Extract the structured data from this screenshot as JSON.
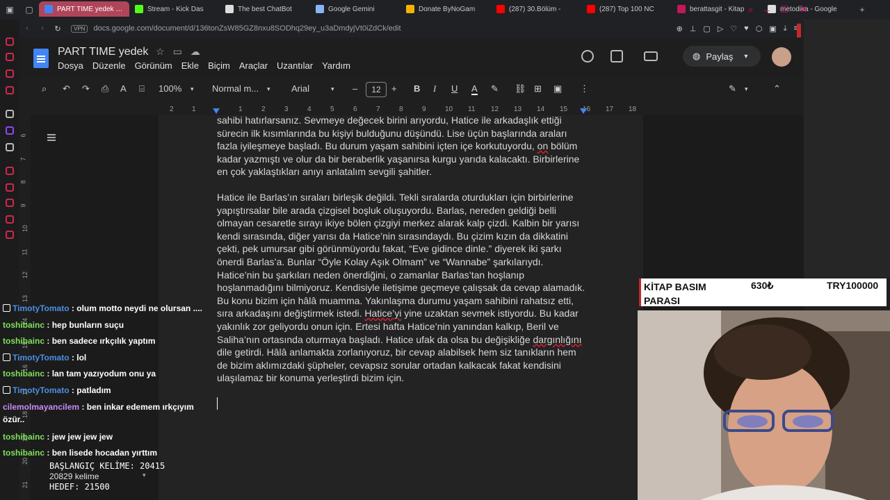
{
  "browser": {
    "tabs": [
      {
        "label": "PART TIME yedek - Goog",
        "color": "#4285f4",
        "active": true
      },
      {
        "label": "Stream - Kick Das",
        "color": "#53fc18"
      },
      {
        "label": "The best ChatBot",
        "color": "#dddddd"
      },
      {
        "label": "Google Gemini",
        "color": "#8ab4f8"
      },
      {
        "label": "Donate ByNoGam",
        "color": "#f4b400"
      },
      {
        "label": "(287) 30.Bölüm -",
        "color": "#ff0000"
      },
      {
        "label": "(287) Top 100 NC",
        "color": "#ff0000"
      },
      {
        "label": "berattasgit - Kitap",
        "color": "#c2185b"
      },
      {
        "label": "metodika - Google",
        "color": "#dddddd"
      }
    ],
    "vpn": "VPN",
    "url": "docs.google.com/document/d/136tonZsW85GZ8nxu8SODhq29ey_u3aDmdyjVt0iZdCk/edit"
  },
  "doc": {
    "title": "PART TIME  yedek",
    "menu": [
      "Dosya",
      "Düzenle",
      "Görünüm",
      "Ekle",
      "Biçim",
      "Araçlar",
      "Uzantılar",
      "Yardım"
    ],
    "share": "Paylaş",
    "toolbar": {
      "zoom": "100%",
      "style": "Normal m...",
      "font": "Arial",
      "size": "12"
    },
    "ruler": [
      "2",
      "1",
      "1",
      "2",
      "3",
      "4",
      "5",
      "6",
      "7",
      "8",
      "9",
      "10",
      "11",
      "12",
      "13",
      "14",
      "15",
      "16",
      "17",
      "18"
    ],
    "vruler": [
      "6",
      "7",
      "8",
      "9",
      "10",
      "11",
      "12",
      "13",
      "14",
      "15",
      "16",
      "17",
      "18",
      "19",
      "20",
      "21"
    ],
    "p1": {
      "pre": "sahibi hatırlarsanız. Sevmeye değecek birini arıyordu, Hatice ile arkadaşlık ettiği sürecin ilk kısımlarında bu kişiyi bulduğunu düşündü. Lise üçün başlarında araları fazla iyileşmeye başladı. Bu durum yaşam sahibini içten içe korkutuyordu, ",
      "squig": "on",
      "post": " bölüm kadar yazmıştı ve olur da bir beraberlik yaşanırsa kurgu yarıda kalacaktı. Birbirlerine en çok yaklaştıkları anıyı anlatalım sevgili şahitler."
    },
    "p2": {
      "a": "Hatice ile Barlas’ın sıraları birleşik değildi. Tekli sıralarda oturdukları için birbirlerine yapıştırsalar bile arada çizgisel boşluk oluşuyordu. Barlas, nereden geldiği belli olmayan cesaretle sırayı ikiye bölen çizgiyi merkez alarak kalp çizdi. Kalbin bir yarısı kendi sırasında, diğer yarısı da Hatice’nin sırasındaydı. Bu çizim kızın da dikkatini çekti, pek umursar gibi görünmüyordu fakat, “Eve gidince dinle.” diyerek iki şarkı önerdi Barlas’a. Bunlar “Öyle Kolay Aşık Olmam” ve “Wannabe” şarkılarıydı. Hatice’nin bu şarkıları neden önerdiğini, o zamanlar Barlas’tan hoşlanıp hoşlanmadığını bilmiyoruz. Kendisiyle iletişime geçmeye çalışsak da cevap alamadık. Bu konu bizim için hâlâ muamma. Yakınlaşma durumu yaşam sahibini rahatsız etti, sıra arkadaşını değiştirmek istedi. ",
      "squig1": "Hatice’yi",
      "b": " yine uzaktan sevmek istiyordu. Bu kadar yakınlık zor geliyordu onun için. Ertesi hafta Hatice’nin yanından kalkıp, Beril ve Saliha’nın ortasında oturmaya başladı. Hatice ufak da olsa bu değişikliğe ",
      "squig2": "dargınlığını",
      "c": " dile getirdi. Hâlâ anlamakta zorlanıyoruz, bir cevap alabilsek hem siz tanıkların hem de bizim aklımızdaki şüpheler, cevapsız sorular ortadan kalkacak fakat kendisini ulaşılamaz bir konuma yerleştirdi bizim için."
    }
  },
  "overlay": {
    "goal_label": "KİTAP BASIM PARASI",
    "goal_current": "630₺",
    "goal_target": "TRY100000",
    "start_words": "BAŞLANGIÇ KELİME: 20415",
    "word_count": "20829 kelime",
    "target": "HEDEF: 21500"
  },
  "chat": [
    {
      "user": "TimotyTomato",
      "text": ": olum motto neydi ne olursan ....",
      "color": "blue",
      "badge": true
    },
    {
      "user": "toshibainc",
      "text": ": hep bunların suçu",
      "color": "green"
    },
    {
      "user": "toshibainc",
      "text": ": ben sadece ırkçılık yaptım",
      "color": "green"
    },
    {
      "user": "TimotyTomato",
      "text": ": lol",
      "color": "blue",
      "badge": true
    },
    {
      "user": "toshibainc",
      "text": ": lan tam yazıyodum onu ya",
      "color": "green"
    },
    {
      "user": "TimotyTomato",
      "text": ": patladım",
      "color": "blue",
      "badge": true
    },
    {
      "user": "cilemolmayancilem",
      "text": ": ben inkar edemem ırkçıyım özür..",
      "color": "pink"
    },
    {
      "user": "toshibainc",
      "text": ": jew jew jew jew",
      "color": "green"
    },
    {
      "user": "toshibainc",
      "text": ": ben lisede hocadan yırttım",
      "color": "green"
    }
  ]
}
